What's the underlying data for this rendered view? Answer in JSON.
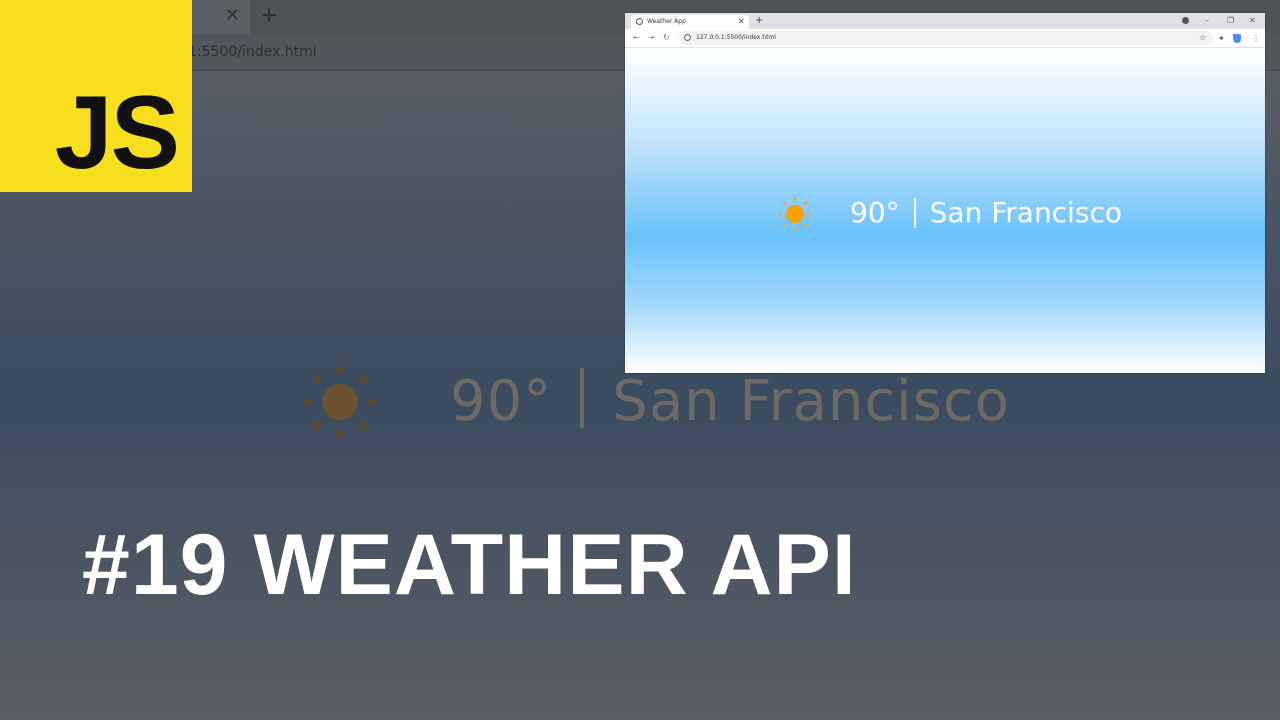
{
  "background": {
    "url": "1:5500/index.html",
    "weather": {
      "temperature": "90°",
      "city": "San Francisco"
    }
  },
  "logo": {
    "text": "JS"
  },
  "title": "#19 WEATHER API",
  "window": {
    "tab_title": "Weather App",
    "url": "127.0.0.1:5500/index.html",
    "weather": {
      "temperature": "90°",
      "city": "San Francisco",
      "icon": "sun-icon"
    }
  },
  "colors": {
    "js_yellow": "#f7df1e",
    "sun_orange": "#f5a300"
  }
}
